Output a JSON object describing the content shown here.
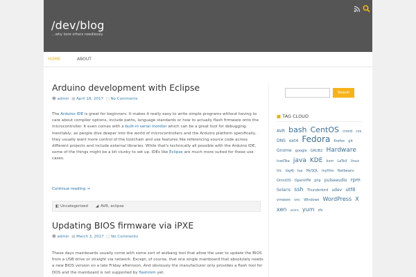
{
  "header": {
    "title": "/dev/blog",
    "tagline": "...why bore others needlessly",
    "rss_icon": "rss-icon",
    "search_icon": "search-icon"
  },
  "nav": {
    "home": "HOME",
    "about": "ABOUT"
  },
  "post1": {
    "title": "Arduino development with Eclipse",
    "author": "admin",
    "date": "April 18, 2017",
    "comments": "No Comments",
    "p1_a": "The ",
    "p1_link1": "Arduino IDE",
    "p1_b": " is great for beginners: It makes it really easy to write simple programs without having to care about compiler options, include paths, language standards or how to actually flash firmware onto the microcontroller. It even comes with a ",
    "p1_link2": "built-in serial monitor",
    "p1_c": " which can be a great tool for debugging.",
    "p2_a": "Inevitably, as people dive deeper into the world of microcontrollers and the Arduino platform specifically, they usually want more control of the toolchain and use features like referencing source code across different projects and include external libraries. While that's technically all possible with the Arduino IDE, some of the things might be a bit clunky to set up. IDEs like ",
    "p2_link": "Eclipse",
    "p2_b": " are much more suited for these use cases.",
    "continue": "Continue reading →",
    "category": "Uncategorized",
    "tags": "AVR, eclipse"
  },
  "post2": {
    "title": "Updating BIOS firmware via iPXE",
    "author": "admin",
    "date": "March 3, 2017",
    "comments": "No Comments",
    "p1_a": "These days mainboards usually come with some sort of wizbang tool that allow the user to update the BIOS from a USB drive or straight via network. Except, of course, that one single mainboard that absolutely needs a new BIOS version on a late Friday afternoon. And obviously the manufacturer only provides a flash tool for DOS and the mainboard is not supported by ",
    "p1_link": "flashrom",
    "p1_b": " yet."
  },
  "sidebar": {
    "search_placeholder": "",
    "search_button": "Search",
    "tag_cloud_title": "TAG CLOUD",
    "tags": [
      {
        "t": "AVR",
        "s": 6
      },
      {
        "t": "bash",
        "s": 11
      },
      {
        "t": "CentOS",
        "s": 11
      },
      {
        "t": "crond",
        "s": 5
      },
      {
        "t": "css",
        "s": 5
      },
      {
        "t": "DNS",
        "s": 6
      },
      {
        "t": "ext4",
        "s": 6
      },
      {
        "t": "Fedora",
        "s": 12
      },
      {
        "t": "firefox",
        "s": 5
      },
      {
        "t": "git",
        "s": 5
      },
      {
        "t": "Gnome",
        "s": 6
      },
      {
        "t": "google",
        "s": 5
      },
      {
        "t": "GRUB2",
        "s": 5
      },
      {
        "t": "Hardware",
        "s": 9
      },
      {
        "t": "IcedTea",
        "s": 5
      },
      {
        "t": "java",
        "s": 9
      },
      {
        "t": "KDE",
        "s": 9
      },
      {
        "t": "kvm",
        "s": 5
      },
      {
        "t": "LaTeX",
        "s": 5
      },
      {
        "t": "linux",
        "s": 5
      },
      {
        "t": "lirc",
        "s": 5
      },
      {
        "t": "log4j",
        "s": 5
      },
      {
        "t": "lua",
        "s": 5
      },
      {
        "t": "MySQL",
        "s": 5
      },
      {
        "t": "mythtv",
        "s": 5
      },
      {
        "t": "Netbeans",
        "s": 5
      },
      {
        "t": "OmniOS",
        "s": 5
      },
      {
        "t": "OpenVPN",
        "s": 5
      },
      {
        "t": "php",
        "s": 5
      },
      {
        "t": "pulseaudio",
        "s": 6
      },
      {
        "t": "rpm",
        "s": 7
      },
      {
        "t": "Solaris",
        "s": 6
      },
      {
        "t": "ssh",
        "s": 8
      },
      {
        "t": "Thunderbird",
        "s": 5
      },
      {
        "t": "udev",
        "s": 6
      },
      {
        "t": "utf8",
        "s": 7
      },
      {
        "t": "vmware",
        "s": 5
      },
      {
        "t": "vnc",
        "s": 5
      },
      {
        "t": "Windows",
        "s": 5
      },
      {
        "t": "WordPress",
        "s": 8
      },
      {
        "t": "X",
        "s": 8
      },
      {
        "t": "xen",
        "s": 8
      },
      {
        "t": "xmms",
        "s": 4
      },
      {
        "t": "yum",
        "s": 8
      },
      {
        "t": "zfs",
        "s": 5
      }
    ]
  },
  "colors": {
    "accent": "#e6b021",
    "link": "#1f6fa6",
    "header_bg": "#555555"
  }
}
